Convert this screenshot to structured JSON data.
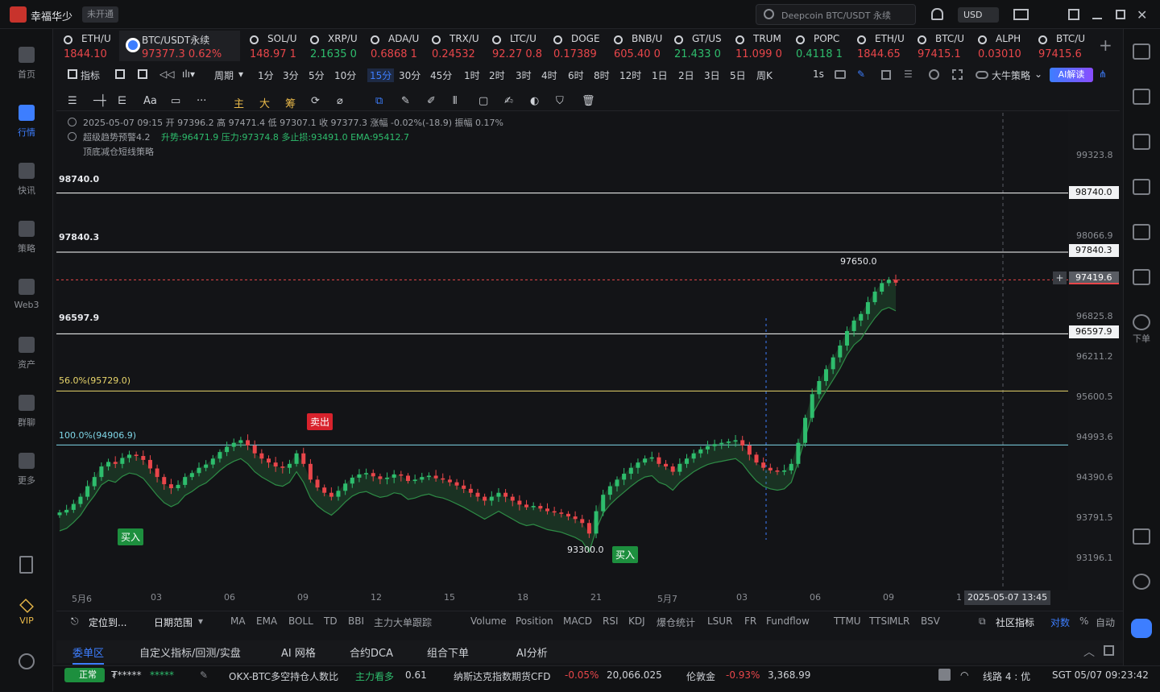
{
  "app": {
    "name": "幸福华少",
    "status_tag": "未开通",
    "search_placeholder": "Deepcoin BTC/USDT 永续",
    "currency": "USD"
  },
  "sidebar": [
    {
      "label": "首页",
      "active": false
    },
    {
      "label": "行情",
      "active": true
    },
    {
      "label": "快讯",
      "active": false
    },
    {
      "label": "策略",
      "active": false
    },
    {
      "label": "Web3",
      "active": false
    },
    {
      "label": "资产",
      "active": false
    },
    {
      "label": "群聊",
      "active": false
    },
    {
      "label": "更多",
      "active": false
    }
  ],
  "sidebar_bottom": {
    "vip": "VIP"
  },
  "right_sidebar": {
    "order_label": "下单"
  },
  "tabs": [
    {
      "name": "ETH/U",
      "price": "1844.10",
      "dir": "down"
    },
    {
      "name": "BTC/USDT永续",
      "price": "97377.3 0.62%",
      "dir": "down",
      "active": true
    },
    {
      "name": "SOL/U",
      "price": "148.97 1",
      "dir": "down"
    },
    {
      "name": "XRP/U",
      "price": "2.1635 0",
      "dir": "up"
    },
    {
      "name": "ADA/U",
      "price": "0.6868 1",
      "dir": "down"
    },
    {
      "name": "TRX/U",
      "price": "0.24532",
      "dir": "down"
    },
    {
      "name": "LTC/U",
      "price": "92.27 0.8",
      "dir": "down"
    },
    {
      "name": "DOGE",
      "price": "0.17389",
      "dir": "down"
    },
    {
      "name": "BNB/U",
      "price": "605.40 0",
      "dir": "down"
    },
    {
      "name": "GT/US",
      "price": "21.433 0",
      "dir": "up"
    },
    {
      "name": "TRUM",
      "price": "11.099 0",
      "dir": "down"
    },
    {
      "name": "POPC",
      "price": "0.4118 1",
      "dir": "up"
    },
    {
      "name": "ETH/U",
      "price": "1844.65",
      "dir": "down"
    },
    {
      "name": "BTC/U",
      "price": "97415.1",
      "dir": "down"
    },
    {
      "name": "ALPH",
      "price": "0.03010",
      "dir": "down"
    },
    {
      "name": "BTC/U",
      "price": "97415.6",
      "dir": "down"
    }
  ],
  "toolbar": {
    "indicator": "指标",
    "period": "周期",
    "intervals": [
      "1分",
      "3分",
      "5分",
      "10分",
      "15分",
      "30分",
      "45分",
      "1时",
      "2时",
      "3时",
      "4时",
      "6时",
      "8时",
      "12时",
      "1日",
      "2日",
      "3日",
      "5日",
      "周K"
    ],
    "selected_interval": "15分",
    "tick": "1s",
    "strategy": "大牛策略",
    "ai": "AI解读"
  },
  "toolbar2": {
    "labels": [
      "主",
      "大",
      "筹"
    ]
  },
  "info": {
    "ohlc": "2025-05-07 09:15  开 97396.2  高 97471.4  低 97307.1  收 97377.3  涨幅 -0.02%(-18.9)  振幅 0.17%",
    "ind1_name": "超级趋势预警4.2",
    "ind1_vals": "升势:96471.9  压力:97374.8  多止损:93491.0  EMA:95412.7",
    "ind2": "顶底减仓短线策略"
  },
  "chart_data": {
    "type": "candlestick",
    "y_range": [
      93000,
      99600
    ],
    "y_ticks": [
      "99323.8",
      "98066.9",
      "96825.8",
      "96211.2",
      "95600.5",
      "94993.6",
      "94390.6",
      "93791.5",
      "93196.1"
    ],
    "y_tick_values": [
      99323.8,
      98066.9,
      96825.8,
      96211.2,
      95600.5,
      94993.6,
      94390.6,
      93791.5,
      93196.1
    ],
    "x_ticks": [
      "5月6",
      "03",
      "06",
      "09",
      "12",
      "15",
      "18",
      "21",
      "5月7",
      "03",
      "06",
      "09",
      "1"
    ],
    "hlines": [
      {
        "label": "98740.0",
        "value": 98740.0,
        "color": "#ffffff"
      },
      {
        "label": "97840.3",
        "value": 97840.3,
        "color": "#ffffff"
      },
      {
        "label": "96597.9",
        "value": 96597.9,
        "color": "#ffffff"
      },
      {
        "label": "56.0%(95729.0)",
        "value": 95729.0,
        "color": "#e9d66b"
      },
      {
        "label": "100.0%(94906.9)",
        "value": 94906.9,
        "color": "#7fd7e8"
      }
    ],
    "current_price": "97419.6",
    "current_price_value": 97419.6,
    "annotations": {
      "high": "97650.0",
      "low": "93300.0",
      "buy": "买入",
      "sell": "卖出"
    },
    "cursor_time": "2025-05-07 13:45",
    "closes": [
      93880,
      93920,
      94010,
      94120,
      94280,
      94420,
      94580,
      94650,
      94620,
      94710,
      94760,
      94740,
      94680,
      94550,
      94420,
      94310,
      94250,
      94300,
      94420,
      94480,
      94560,
      94610,
      94700,
      94800,
      94880,
      94940,
      94980,
      94900,
      94780,
      94700,
      94640,
      94580,
      94560,
      94620,
      94780,
      94620,
      94380,
      94260,
      94180,
      94120,
      94210,
      94320,
      94410,
      94460,
      94480,
      94430,
      94390,
      94410,
      94460,
      94440,
      94360,
      94380,
      94420,
      94440,
      94400,
      94380,
      94340,
      94290,
      94240,
      94180,
      94120,
      94060,
      94120,
      94180,
      94120,
      94060,
      94000,
      93960,
      93980,
      93940,
      93900,
      93880,
      93860,
      93820,
      93780,
      93720,
      93560,
      93900,
      94150,
      94280,
      94380,
      94470,
      94560,
      94640,
      94700,
      94720,
      94620,
      94580,
      94500,
      94620,
      94700,
      94780,
      94840,
      94890,
      94920,
      94940,
      94960,
      94980,
      94900,
      94760,
      94640,
      94560,
      94520,
      94500,
      94520,
      94620,
      94940,
      95320,
      95680,
      95880,
      96060,
      96240,
      96420,
      96640,
      96800,
      96900,
      97080,
      97240,
      97370,
      97420,
      97377
    ]
  },
  "bottom_bar": {
    "locate": "定位到...",
    "date_range": "日期范围",
    "indicators": [
      "MA",
      "EMA",
      "BOLL",
      "TD",
      "BBI",
      "主力大单跟踪",
      "Volume",
      "Position",
      "MACD",
      "RSI",
      "KDJ",
      "爆仓统计",
      "LSUR",
      "FR",
      "Fundflow",
      "TTMU",
      "TTSI",
      "MLR",
      "BSV"
    ],
    "community": "社区指标",
    "log": "对数",
    "pct": "%",
    "auto": "自动"
  },
  "bottom_tabs": [
    "委单区",
    "自定义指标/回测/实盘",
    "AI 网格",
    "合约DCA",
    "组合下单",
    "AI分析"
  ],
  "status": {
    "conn": "正常",
    "account": "₮*****",
    "account2": "*****",
    "ticker1_name": "OKX-BTC多空持仓人数比",
    "ticker1_tag": "主力看多",
    "ticker1_val": "0.61",
    "ticker2_name": "纳斯达克指数期货CFD",
    "ticker2_chg": "-0.05%",
    "ticker2_val": "20,066.025",
    "ticker3_name": "伦敦金",
    "ticker3_chg": "-0.93%",
    "ticker3_val": "3,368.99",
    "line": "线路 4 : 优",
    "time": "SGT 05/07 09:23:42"
  }
}
